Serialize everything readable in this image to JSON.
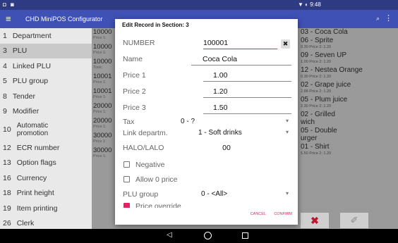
{
  "status": {
    "left_icons": "◘ ◙",
    "right": "▼ ◐ 9:48"
  },
  "appbar": {
    "menu_icon": "≡",
    "title": "CHD MiniPOS Configurator",
    "search_icon": "⌕",
    "more_icon": "⋮"
  },
  "sidebar": [
    {
      "num": "1",
      "label": "Department"
    },
    {
      "num": "3",
      "label": "PLU",
      "active": true
    },
    {
      "num": "4",
      "label": "Linked PLU"
    },
    {
      "num": "5",
      "label": "PLU group"
    },
    {
      "num": "8",
      "label": "Tender"
    },
    {
      "num": "9",
      "label": "Modifier"
    },
    {
      "num": "10",
      "label": "Automatic promotion",
      "two": true
    },
    {
      "num": "12",
      "label": "ECR number"
    },
    {
      "num": "13",
      "label": "Option flags"
    },
    {
      "num": "16",
      "label": "Currency"
    },
    {
      "num": "18",
      "label": "Print height"
    },
    {
      "num": "19",
      "label": "Item printing"
    },
    {
      "num": "26",
      "label": "Clerk"
    }
  ],
  "middle": [
    {
      "top": "10000",
      "sub": "Price 1:"
    },
    {
      "top": "10000",
      "sub": "Price 1:"
    },
    {
      "top": "10000",
      "sub": "Tonic"
    },
    {
      "top": "10001",
      "sub": "Price 1:"
    },
    {
      "top": "10001",
      "sub": "Price 1:"
    },
    {
      "top": "20000",
      "sub": "Price 1:"
    },
    {
      "top": "20000",
      "sub": "Price 1:"
    },
    {
      "top": "30000",
      "sub": "Price 1:"
    },
    {
      "top": "30000",
      "sub": "Price 1:"
    }
  ],
  "right_list": [
    {
      "top": "03 - Coca Cola",
      "sub": ""
    },
    {
      "top": "06 - Sprite",
      "sub": "0.30 Price 2: 1.20"
    },
    {
      "top": "09 - Seven UP",
      "sub": "1.00 Price 2: 1.20"
    },
    {
      "top": "12 - Nestea Orange",
      "sub": "0.30 Price 2: 1.20"
    },
    {
      "top": "02 - Grape juice",
      "sub": "2.88 Price 2: 1.20"
    },
    {
      "top": "05 - Plum juice",
      "sub": "2.30 Price 2: 1.20"
    },
    {
      "top": "02 - Grilled",
      "sub": ""
    },
    {
      "top": "wich",
      "sub": ""
    },
    {
      "top": "05 - Double",
      "sub": ""
    },
    {
      "top": "urger",
      "sub": ""
    },
    {
      "top": "01 - Shirt",
      "sub": "5.50 Price 2: 1.20"
    }
  ],
  "right_buttons": {
    "delete_icon": "✖",
    "edit_icon": "✐"
  },
  "dialog": {
    "title": "Edit Record in Section: 3",
    "number_label": "NUMBER",
    "number_value": "100001",
    "clear_icon": "✖",
    "name_label": "Name",
    "name_value": "Coca Cola",
    "price1_label": "Price 1",
    "price1_value": "1.00",
    "price2_label": "Price 2",
    "price2_value": "1.20",
    "price3_label": "Price 3",
    "price3_value": "1.50",
    "tax_label": "Tax",
    "tax_value": "0 - ?",
    "link_label": "Link departm.",
    "link_value": "1 - Soft drinks",
    "halo_label": "HALO/LALO",
    "halo_value": "00",
    "negative_label": "Negative",
    "allow0_label": "Allow 0 price",
    "plugroup_label": "PLU group",
    "plugroup_value": "0 - <All>",
    "price_override_label": "Price override",
    "caret": "▾",
    "cancel": "CANCEL",
    "confirm": "CONFIRM"
  },
  "navbar": {
    "back_icon": "◁"
  }
}
